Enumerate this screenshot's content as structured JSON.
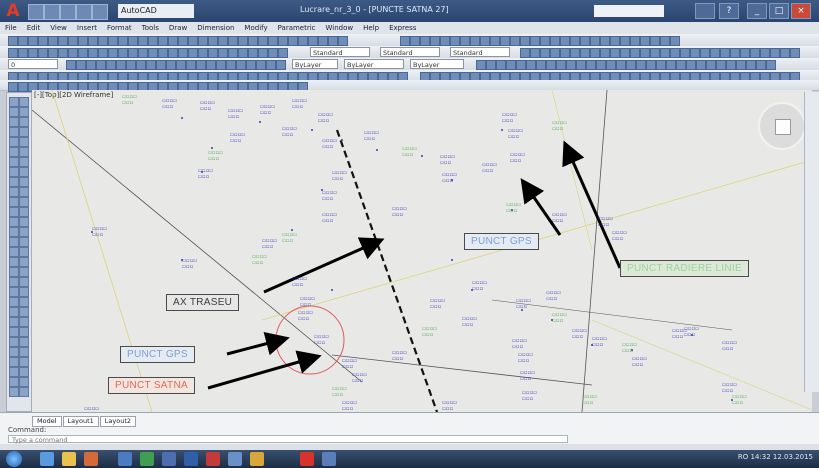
{
  "app": {
    "workspace": "AutoCAD",
    "title": "Lucrare_nr_3_0 - [PUNCTE SATNA 27]"
  },
  "menu": {
    "items": [
      "File",
      "Edit",
      "View",
      "Insert",
      "Format",
      "Tools",
      "Draw",
      "Dimension",
      "Modify",
      "Parametric",
      "Window",
      "Help",
      "Express"
    ]
  },
  "toolbar": {
    "layer_dropdown": "Standard",
    "style_dropdown": "Standard",
    "dim_dropdown": "Standard",
    "layer_state": "0",
    "color_dropdown": "ByLayer",
    "linetype_dropdown": "ByLayer",
    "lineweight_dropdown": "ByLayer"
  },
  "canvas": {
    "viewport_label": "[-][Top][2D Wireframe]",
    "annotations": [
      {
        "name": "ax-traseu-label",
        "text": "AX TRASEU",
        "color": "#3b3b3b",
        "bg": "#e6e6e6"
      },
      {
        "name": "punct-gps-label-1",
        "text": "PUNCT GPS",
        "color": "#7b9fd0",
        "bg": "#e4ebf2"
      },
      {
        "name": "punct-gps-label-2",
        "text": "PUNCT GPS",
        "color": "#7b9fd0",
        "bg": "#e4ebf2"
      },
      {
        "name": "punct-satna-label",
        "text": "PUNCT SATNA",
        "color": "#e06a55",
        "bg": "#f2e6e0"
      },
      {
        "name": "punct-radiere-label",
        "text": "PUNCT RADIERE LINIE",
        "color": "#9bd49b",
        "bg": "#dde8d8"
      }
    ]
  },
  "command": {
    "tabs": [
      "Model",
      "Layout1",
      "Layout2"
    ],
    "history": "Command:",
    "prompt": "Type a command"
  },
  "tray": {
    "text": "RO  14:32  12.03.2015"
  }
}
